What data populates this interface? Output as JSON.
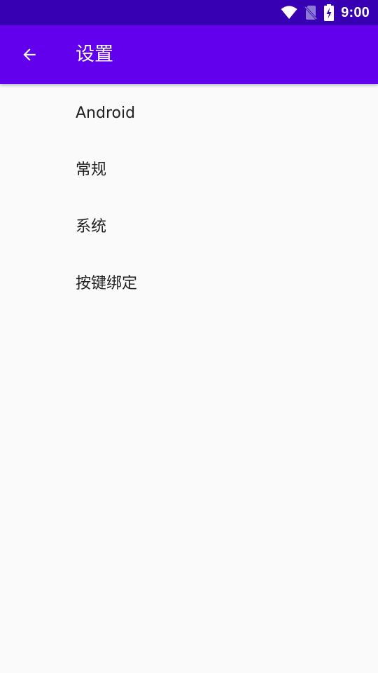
{
  "status_bar": {
    "time": "9:00",
    "icons": [
      "wifi-icon",
      "no-sim-icon",
      "battery-charging-icon"
    ]
  },
  "app_bar": {
    "back_icon": "arrow-back-icon",
    "title": "设置"
  },
  "preferences": [
    {
      "label": "Android"
    },
    {
      "label": "常规"
    },
    {
      "label": "系统"
    },
    {
      "label": "按键绑定"
    }
  ],
  "colors": {
    "status_bar": "#3700B3",
    "app_bar": "#6200EE",
    "background": "#FAFAFA",
    "text_primary": "#212121"
  }
}
